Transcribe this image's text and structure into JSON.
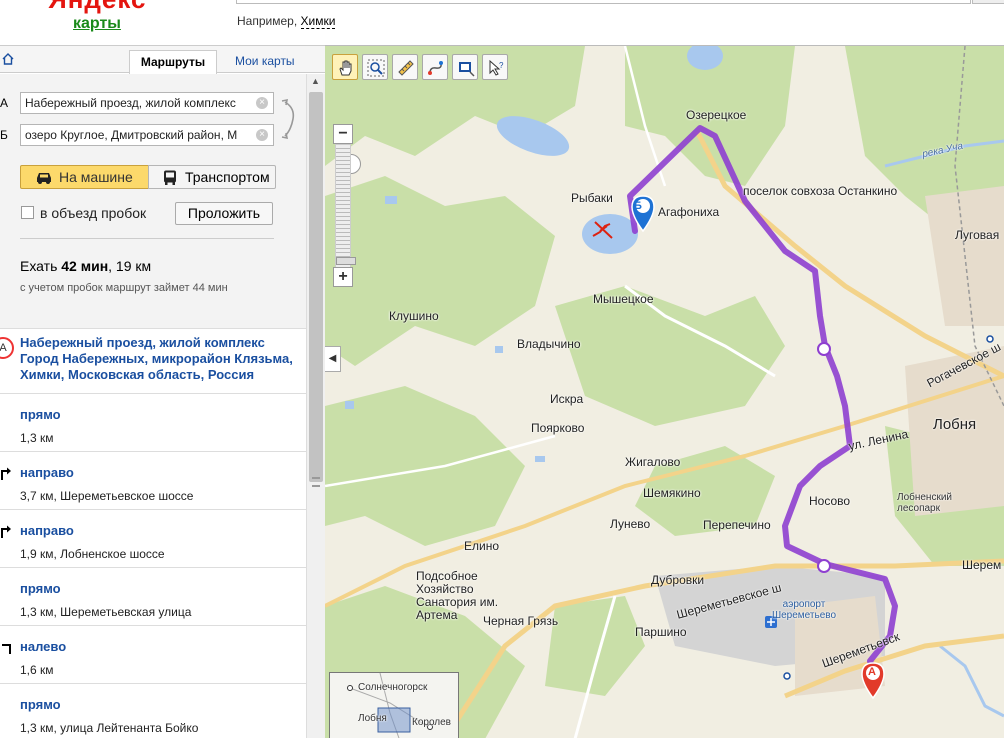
{
  "header": {
    "logo_brand": "Яндекс",
    "logo_product": "карты",
    "example_prefix": "Например,",
    "example_link": "Химки"
  },
  "tabs": {
    "routes": "Маршруты",
    "my_maps": "Мои карты"
  },
  "route_form": {
    "point_a_label": "А",
    "point_a_value": "Набережный проезд, жилой комплекс",
    "point_b_label": "Б",
    "point_b_value": "озеро Круглое, Дмитровский район, М",
    "mode_car": "На машине",
    "mode_transit": "Транспортом",
    "avoid_traffic_label": "в объезд пробок",
    "avoid_traffic_checked": false,
    "build_button": "Проложить",
    "summary_prefix": "Ехать",
    "summary_time": "42 мин",
    "summary_distance": ", 19 км",
    "traffic_note": "с учетом пробок маршрут займет 44 мин"
  },
  "steps": {
    "start_marker": "А",
    "start_address": "Набережный проезд, жилой комплекс Город Набережных, микрорайон Клязьма, Химки, Московская область, Россия",
    "items": [
      {
        "direction": "прямо",
        "info": "1,3 км",
        "turn": "straight"
      },
      {
        "direction": "направо",
        "info": "3,7 км, Шереметьевское шоссе",
        "turn": "right"
      },
      {
        "direction": "направо",
        "info": "1,9 км, Лобненское шоссе",
        "turn": "right"
      },
      {
        "direction": "прямо",
        "info": "1,3 км, Шереметьевская улица",
        "turn": "straight"
      },
      {
        "direction": "налево",
        "info": "1,6 км",
        "turn": "left"
      },
      {
        "direction": "прямо",
        "info": "1,3 км, улица Лейтенанта Бойко",
        "turn": "straight"
      }
    ]
  },
  "map": {
    "labels": {
      "ozeretskoe": "Озерецкое",
      "rybaki": "Рыбаки",
      "agafonikha": "Агафониха",
      "posyolok_ostankino": "поселок совхоза Останкино",
      "luga": "Луговая",
      "reka_ucha": "река Уча",
      "myshetskoe": "Мышецкое",
      "klushino": "Клушино",
      "vladychino": "Владычино",
      "rogachevskoe": "Рогачевское ш",
      "iskra": "Искра",
      "poyarkovo": "Поярково",
      "lobnya": "Лобня",
      "ul_lenina": "ул. Ленина",
      "zhigalovo": "Жигалово",
      "shemyakino": "Шемякино",
      "nosovo": "Носово",
      "lobnensky_lesopark": "Лобненский лесопарк",
      "lunevo": "Лунево",
      "perepechino": "Перепечино",
      "elino": "Елино",
      "podsobnoe": "Подсобное Хозяйство Санатория им. Артема",
      "dubrovki": "Дубровки",
      "sheremetyevskoe_sh": "Шереметьевское ш",
      "sherem_right": "Шерем",
      "airport": "аэропорт Шереметьево",
      "chernaya_gryaz": "Черная Грязь",
      "parshino": "Паршино",
      "sheremetyevsk_road": "Шереметьевск",
      "marker_a": "А",
      "marker_b": "Б"
    },
    "minimap": {
      "solnechnogorsk": "Солнечногорск",
      "lobnya": "Лобня",
      "korolev": "Королев"
    },
    "colors": {
      "route": "#8e3fd0",
      "forest": "#c9dfa8",
      "field": "#f1eee2",
      "water": "#a8c8ee",
      "road_major": "#f3d38a"
    }
  }
}
